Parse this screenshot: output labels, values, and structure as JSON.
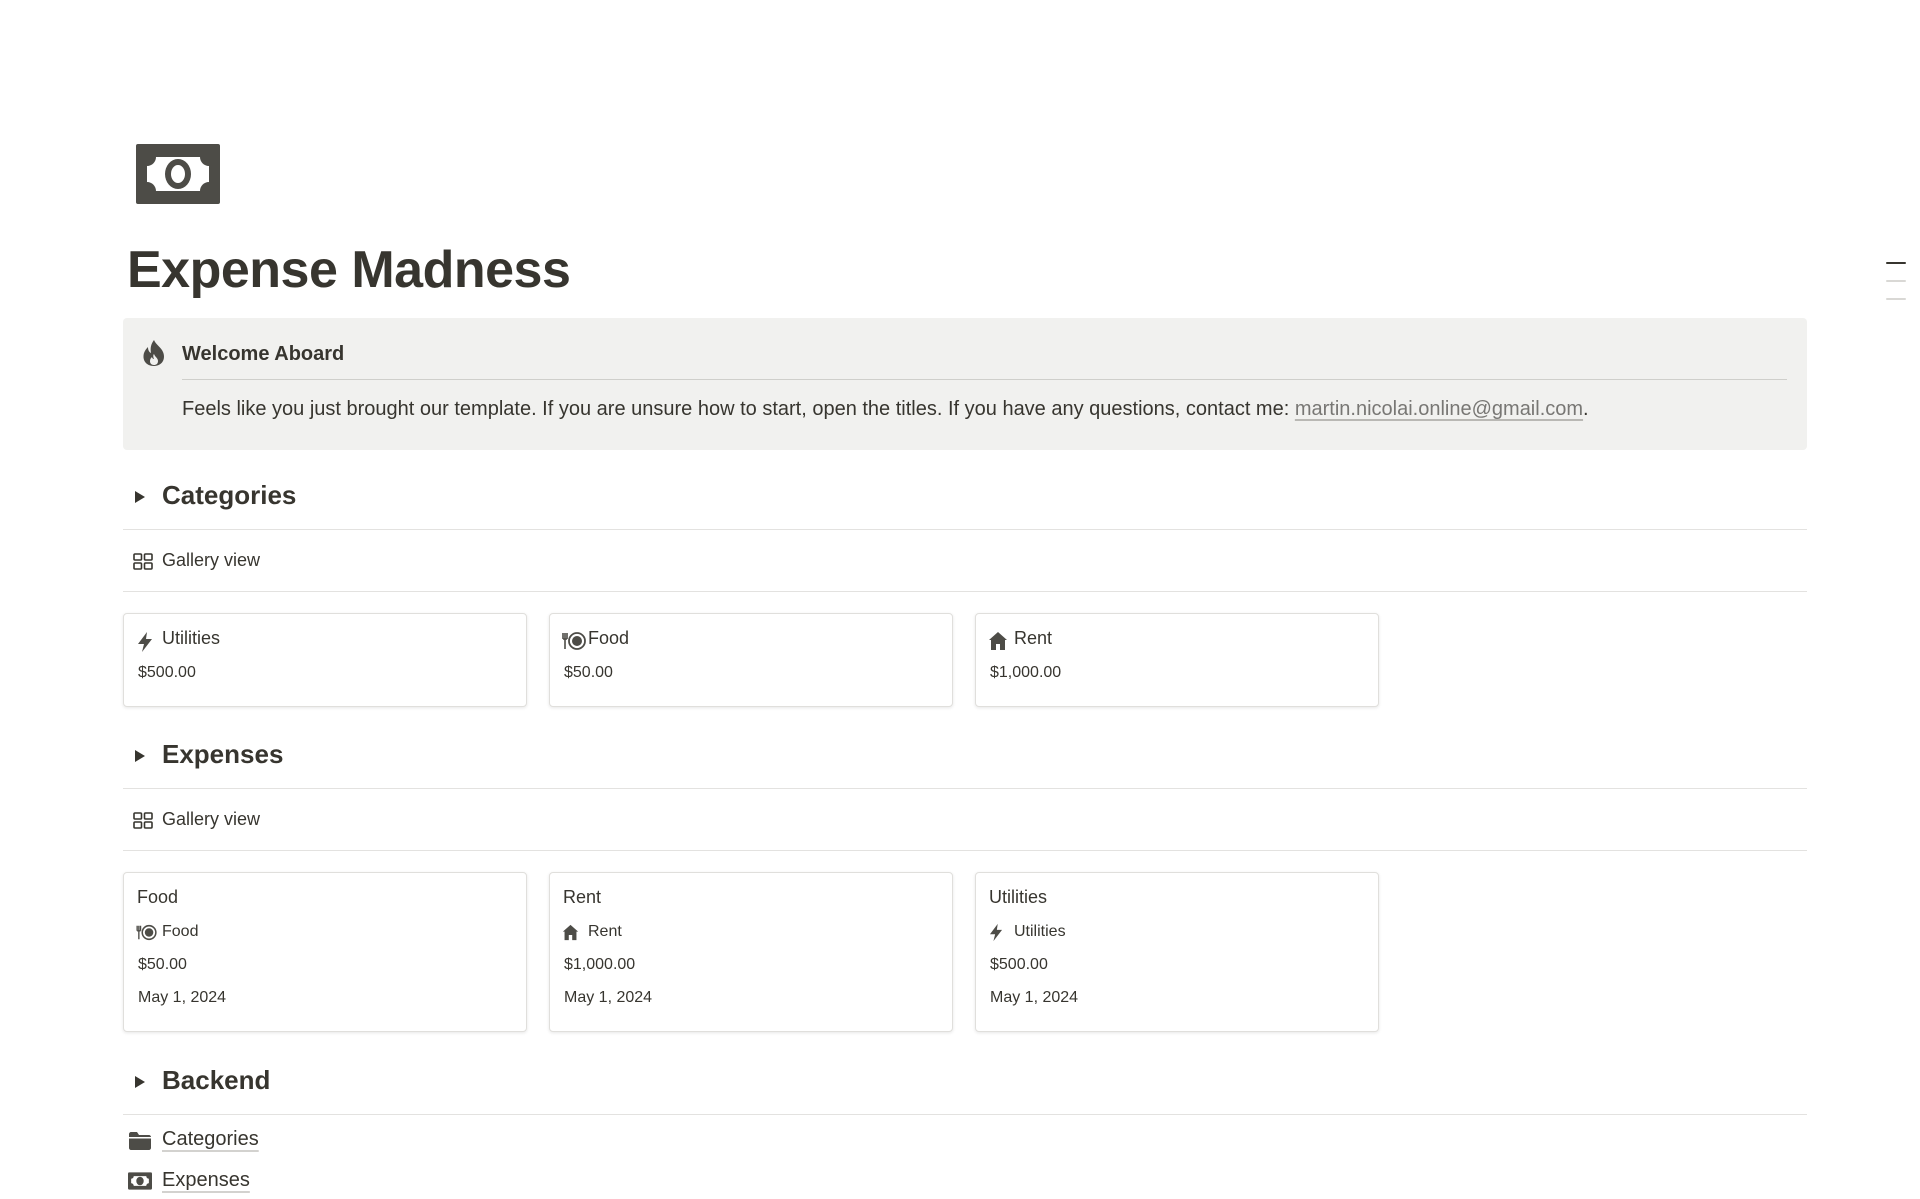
{
  "page": {
    "icon": "dollar-banknote-icon",
    "title": "Expense Madness"
  },
  "callout": {
    "icon": "fire-icon",
    "title": "Welcome Aboard",
    "text_before": "Feels like you just brought our template. If you are unsure how to start, open the titles. If you have any questions, contact me: ",
    "email": "martin.nicolai.online@gmail.com",
    "text_after": "."
  },
  "categories": {
    "heading": "Categories",
    "view_label": "Gallery view",
    "cards": [
      {
        "icon": "lightning-bolt-icon",
        "title": "Utilities",
        "amount": "$500.00"
      },
      {
        "icon": "fork-plate-icon",
        "title": "Food",
        "amount": "$50.00"
      },
      {
        "icon": "house-icon",
        "title": "Rent",
        "amount": "$1,000.00"
      }
    ]
  },
  "expenses": {
    "heading": "Expenses",
    "view_label": "Gallery view",
    "cards": [
      {
        "title": "Food",
        "category_icon": "fork-plate-icon",
        "category": "Food",
        "amount": "$50.00",
        "date": "May 1, 2024"
      },
      {
        "title": "Rent",
        "category_icon": "house-icon",
        "category": "Rent",
        "amount": "$1,000.00",
        "date": "May 1, 2024"
      },
      {
        "title": "Utilities",
        "category_icon": "lightning-bolt-icon",
        "category": "Utilities",
        "amount": "$500.00",
        "date": "May 1, 2024"
      }
    ]
  },
  "backend": {
    "heading": "Backend",
    "links": [
      {
        "icon": "folder-icon",
        "label": "Categories"
      },
      {
        "icon": "dollar-banknote-icon",
        "label": "Expenses"
      }
    ]
  },
  "colors": {
    "text": "#37352f",
    "callout_bg": "#f1f1ef",
    "muted": "#787774",
    "divider": "#e3e2e0",
    "icon_dark": "#4d4c47"
  }
}
